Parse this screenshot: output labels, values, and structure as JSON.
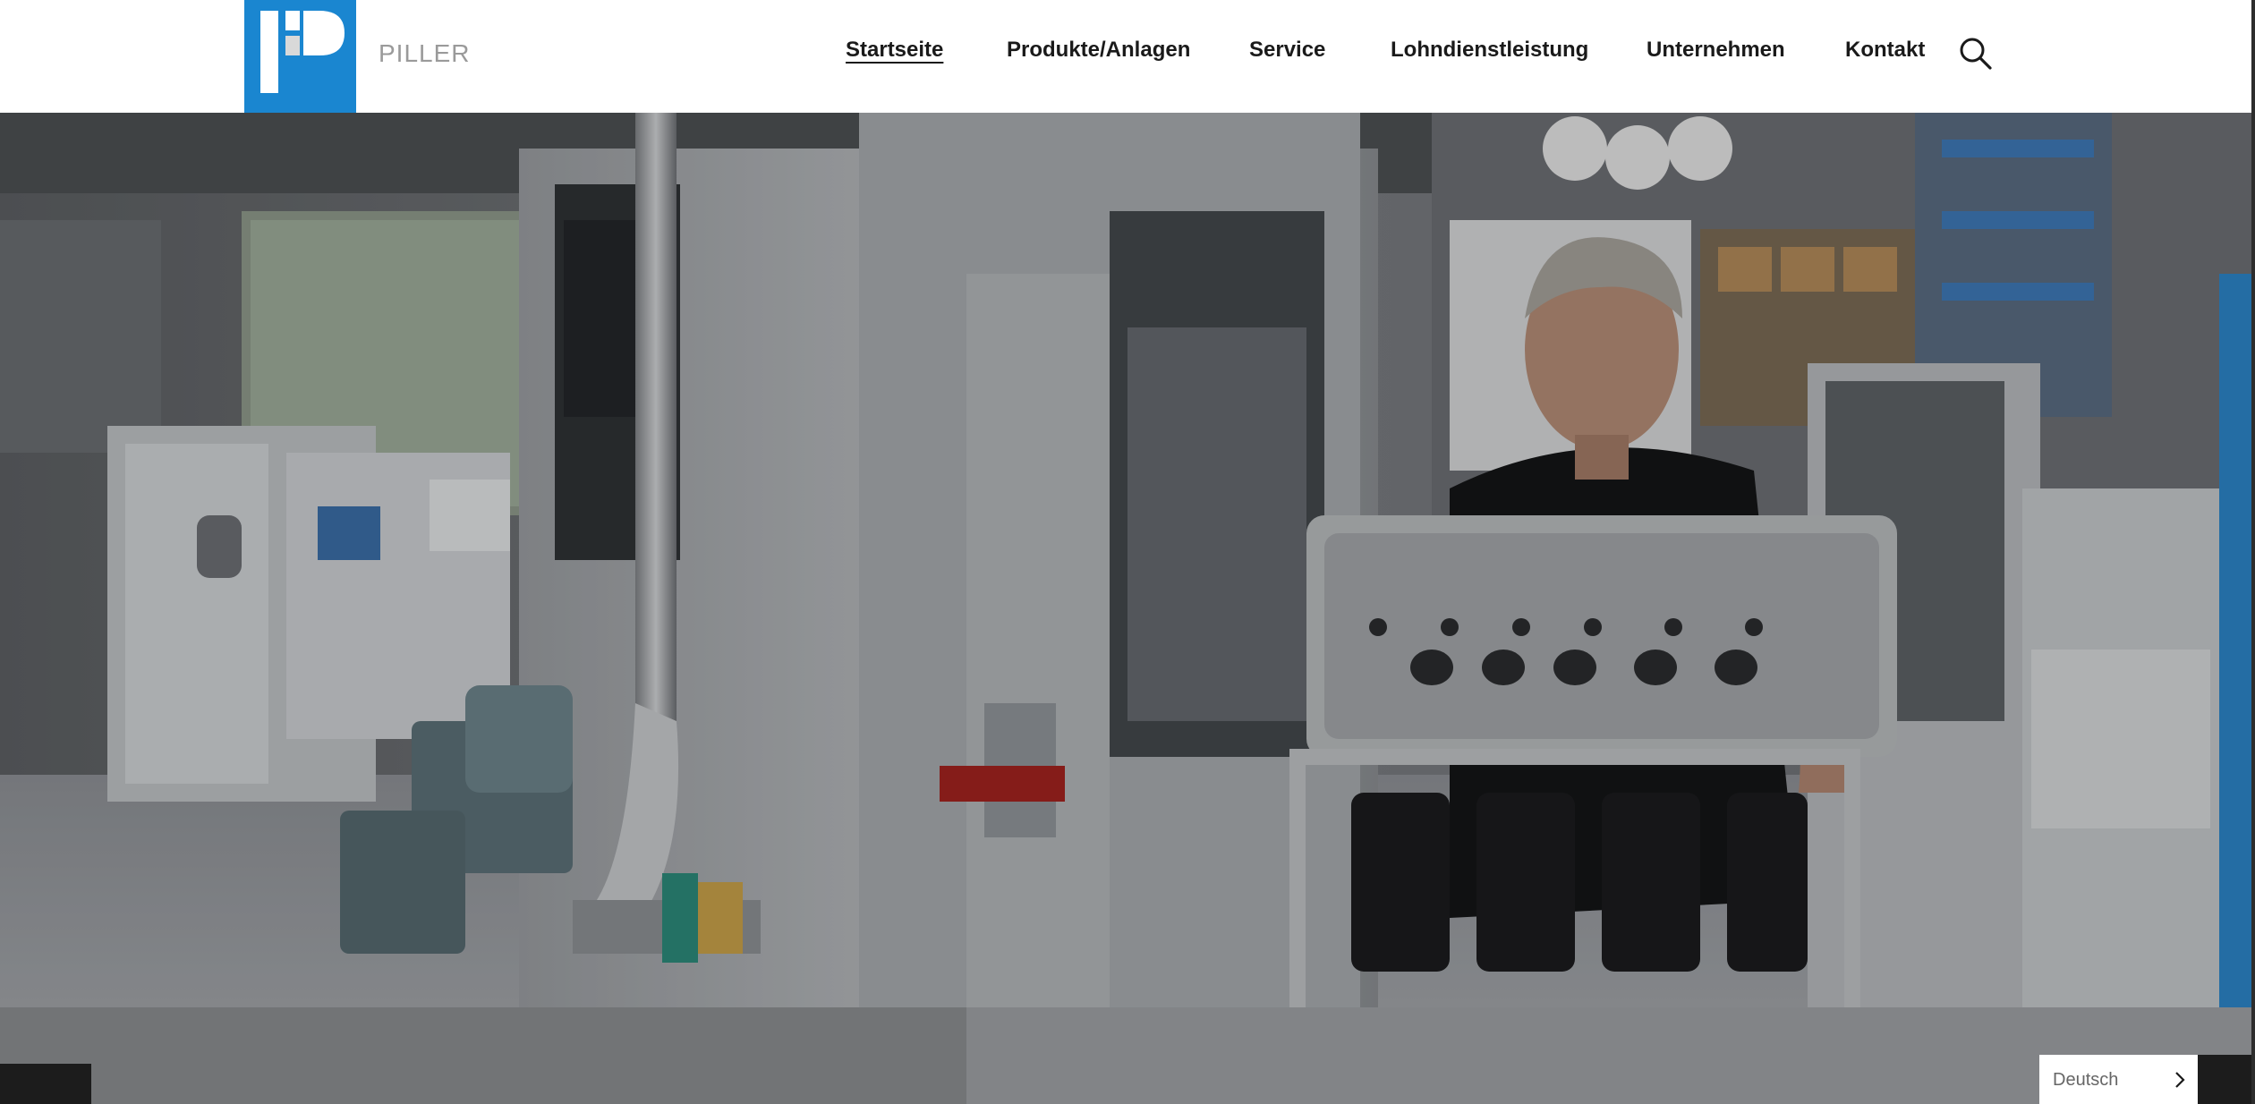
{
  "brand": {
    "name": "PILLER",
    "logo_color": "#1a86d0"
  },
  "nav": {
    "items": [
      {
        "label": "Startseite",
        "active": true
      },
      {
        "label": "Produkte/Anlagen",
        "active": false
      },
      {
        "label": "Service",
        "active": false
      },
      {
        "label": "Lohndienstleistung",
        "active": false
      },
      {
        "label": "Unternehmen",
        "active": false
      },
      {
        "label": "Kontakt",
        "active": false
      }
    ],
    "search_icon": "search-icon"
  },
  "hero": {
    "image": "industrial-machine-with-worker-photo"
  },
  "language": {
    "selected": "Deutsch",
    "chevron_icon": "chevron-right-icon"
  }
}
